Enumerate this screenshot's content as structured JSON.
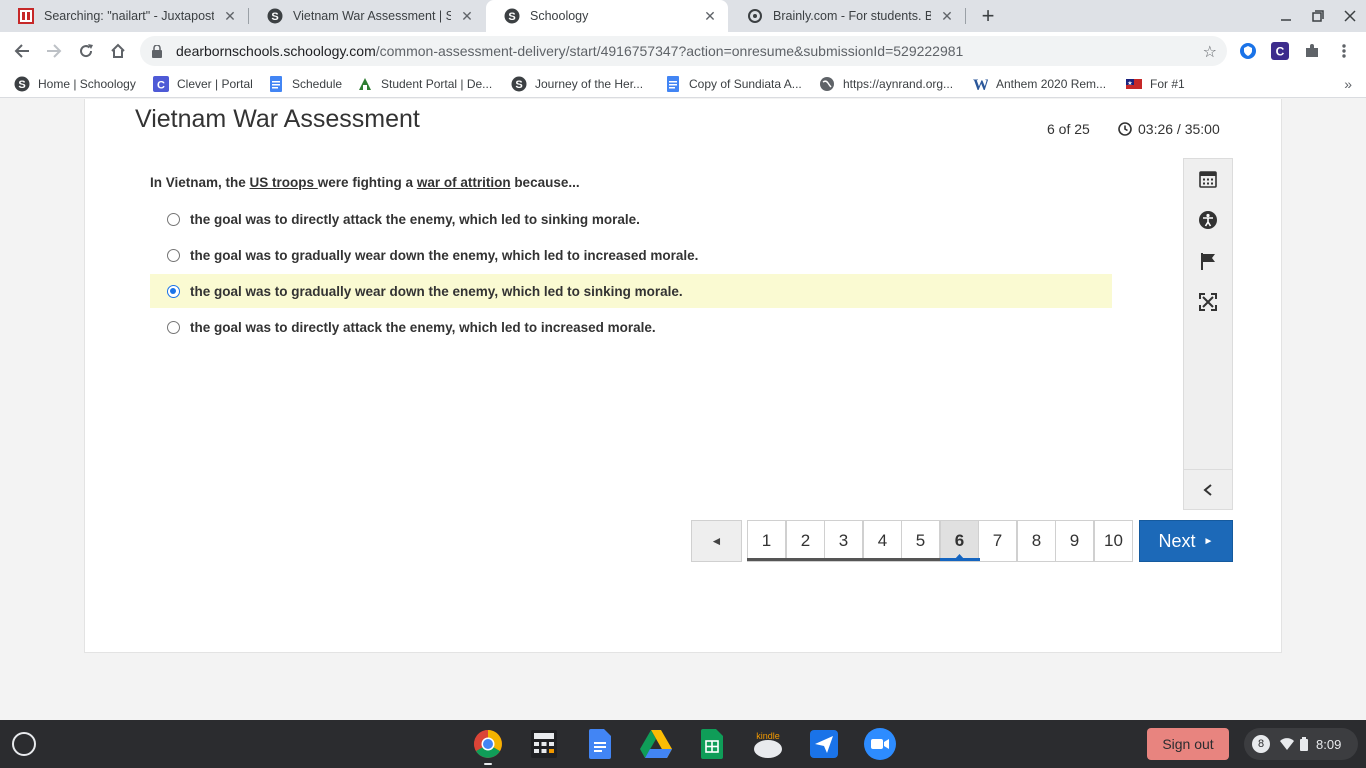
{
  "tabs": [
    {
      "title": "Searching: \"nailart\" - Juxtapost",
      "icon": "juxtapost-icon"
    },
    {
      "title": "Vietnam War Assessment | Scho",
      "icon": "schoology-icon"
    },
    {
      "title": "Schoology",
      "icon": "schoology-icon",
      "active": true
    },
    {
      "title": "Brainly.com - For students. By stu",
      "icon": "brainly-icon"
    }
  ],
  "address_bar": {
    "host": "dearbornschools.schoology.com",
    "path": "/common-assessment-delivery/start/4916757347?action=onresume&submissionId=529222981"
  },
  "bookmarks": [
    {
      "label": "Home | Schoology"
    },
    {
      "label": "Clever | Portal"
    },
    {
      "label": "Schedule"
    },
    {
      "label": "Student Portal | De..."
    },
    {
      "label": "Journey of the Her..."
    },
    {
      "label": "Copy of Sundiata A..."
    },
    {
      "label": "https://aynrand.org..."
    },
    {
      "label": "Anthem 2020 Rem..."
    },
    {
      "label": "For #1"
    }
  ],
  "assessment": {
    "title": "Vietnam War Assessment",
    "counter": "6 of 25",
    "timer": "03:26 / 35:00"
  },
  "question": {
    "prefix": "In Vietnam, the ",
    "term1": "US troops ",
    "middle": "were fighting a ",
    "term2": "war of attrition",
    "suffix": " because..."
  },
  "choices": [
    {
      "text": "the goal was to directly attack the enemy, which led to sinking morale.",
      "selected": false
    },
    {
      "text": "the goal was to gradually wear down the enemy, which led to increased morale.",
      "selected": false
    },
    {
      "text": "the goal was to gradually wear down the enemy, which led to sinking morale.",
      "selected": true
    },
    {
      "text": "the goal was to directly attack the enemy, which led to increased morale.",
      "selected": false
    }
  ],
  "pagination": {
    "prev_symbol": "◄",
    "pages": [
      "1",
      "2",
      "3",
      "4",
      "5",
      "6",
      "7",
      "8",
      "9",
      "10"
    ],
    "current": "6",
    "next_label": "Next",
    "next_symbol": "►"
  },
  "shelf": {
    "signout_label": "Sign out",
    "notification_count": "8",
    "time": "8:09"
  },
  "colors": {
    "selected_bg": "#fafad2",
    "next_button": "#1c69b8",
    "signout": "#e8847f"
  }
}
